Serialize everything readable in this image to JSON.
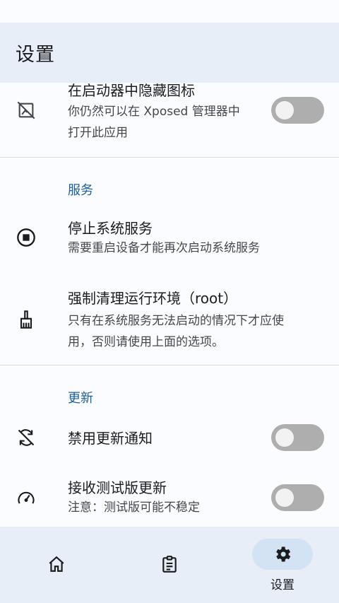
{
  "header": {
    "title": "设置"
  },
  "items": {
    "hide_icon": {
      "title": "在启动器中隐藏图标",
      "subtitle_line1": "你仍然可以在 Xposed 管理器中",
      "subtitle_line2": "打开此应用",
      "icon": "hide-image-icon",
      "toggle_on": false
    },
    "stop_service": {
      "title": "停止系统服务",
      "subtitle": "需要重启设备才能再次启动系统服务",
      "icon": "stop-circle-icon"
    },
    "force_clean": {
      "title": "强制清理运行环境（root）",
      "subtitle_line1": "只有在系统服务无法启动的情况下才应使",
      "subtitle_line2": "用，否则请使用上面的选项。",
      "icon": "broom-icon"
    },
    "disable_update_notify": {
      "title": "禁用更新通知",
      "icon": "sync-disabled-icon",
      "toggle_on": false
    },
    "beta_updates": {
      "title": "接收测试版更新",
      "subtitle": "注意：测试版可能不稳定",
      "icon": "speed-gauge-icon",
      "toggle_on": false
    }
  },
  "sections": {
    "service": "服务",
    "update": "更新"
  },
  "nav": {
    "home_icon": "home-icon",
    "logs_icon": "clipboard-icon",
    "settings_icon": "gear-icon",
    "settings_label": "设置",
    "selected": "settings"
  },
  "colors": {
    "accent": "#1a5f9a",
    "bar_bg": "#e7eef7",
    "pill_bg": "#d3e3f4",
    "toggle_off": "#aeaeae"
  }
}
